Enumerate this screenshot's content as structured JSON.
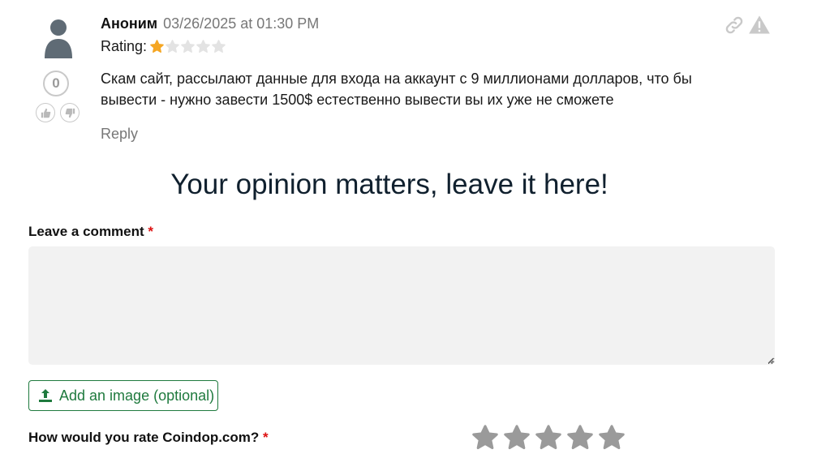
{
  "review": {
    "author": "Аноним",
    "date": "03/26/2025 at 01:30 PM",
    "rating_label": "Rating:",
    "rating_value": 1,
    "rating_max": 5,
    "votes": "0",
    "text": "Скам сайт, рассылают данные для входа на аккаунт с 9 миллионами долларов, что бы вывести - нужно завести 1500$ естественно вывести вы их уже не сможете",
    "reply_label": "Reply"
  },
  "form": {
    "heading": "Your opinion matters, leave it here!",
    "comment_label": "Leave a comment",
    "required_mark": "*",
    "comment_value": "",
    "add_image_label": "Add an image (optional)",
    "rate_label": "How would you rate Coindop.com?",
    "rate_value": 0,
    "rate_max": 5
  },
  "colors": {
    "star_filled": "#f5a623",
    "star_empty": "#e3e3e3",
    "big_star": "#9a9a9a",
    "accent_green": "#1f7a3e",
    "required_red": "#d11111"
  }
}
